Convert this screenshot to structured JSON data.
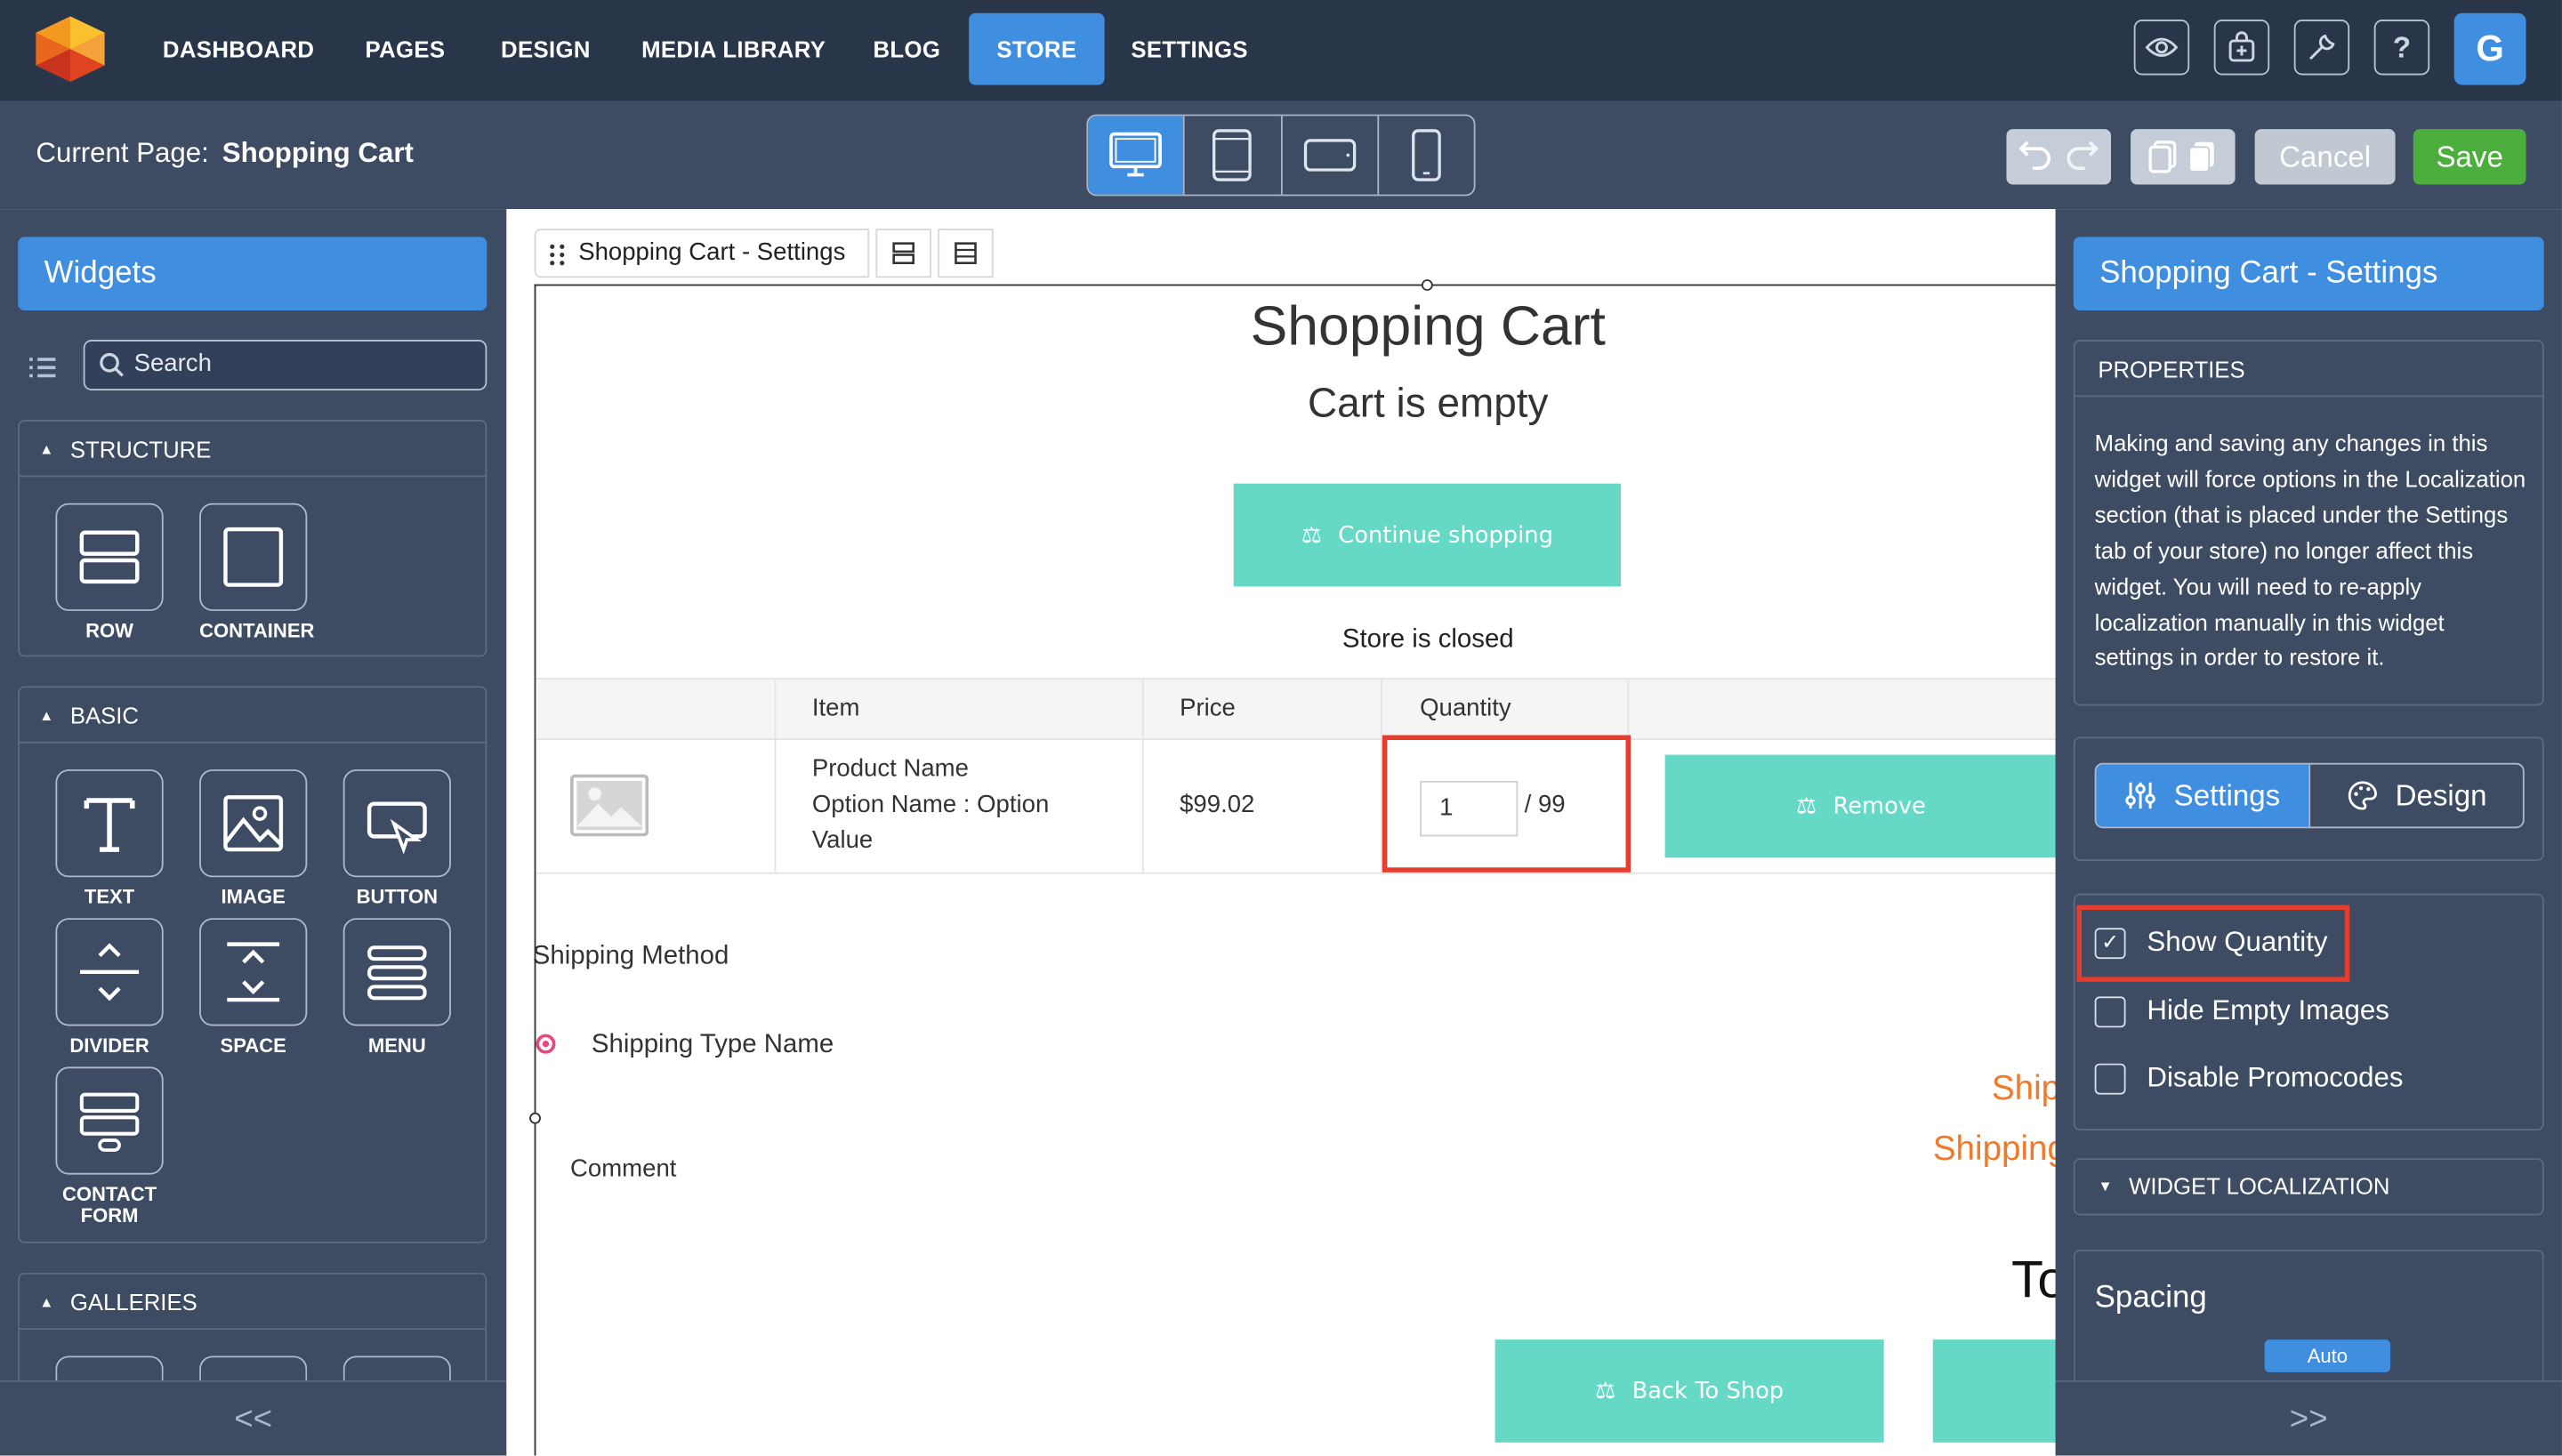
{
  "topnav": {
    "items": [
      "DASHBOARD",
      "PAGES",
      "DESIGN",
      "MEDIA LIBRARY",
      "BLOG",
      "STORE",
      "SETTINGS"
    ],
    "active": "STORE",
    "icons": [
      "eye-icon",
      "store-icon",
      "wrench-icon",
      "help-icon"
    ],
    "help_glyph": "?",
    "avatar_letter": "G"
  },
  "subbar": {
    "current_page_label": "Current Page:",
    "current_page_value": "Shopping Cart",
    "devices": [
      "desktop-icon",
      "tablet-icon",
      "tablet-landscape-icon",
      "mobile-icon"
    ],
    "cancel_label": "Cancel",
    "save_label": "Save"
  },
  "left_panel": {
    "title": "Widgets",
    "search_placeholder": "Search",
    "sections": {
      "structure": {
        "title": "STRUCTURE",
        "widgets": [
          "ROW",
          "CONTAINER"
        ]
      },
      "basic": {
        "title": "BASIC",
        "widgets": [
          "TEXT",
          "IMAGE",
          "BUTTON",
          "DIVIDER",
          "SPACE",
          "MENU",
          "CONTACT FORM"
        ]
      },
      "galleries": {
        "title": "GALLERIES"
      }
    },
    "collapse_glyph": "<<"
  },
  "canvas": {
    "breadcrumb": "Shopping Cart - Settings",
    "heading": "Shopping Cart",
    "empty_message": "Cart is empty",
    "continue_label": "Continue shopping",
    "store_closed": "Store is closed",
    "table": {
      "headers": [
        "Item",
        "Price",
        "Quantity"
      ],
      "row": {
        "item_lines": [
          "Product Name",
          "Option Name : Option",
          "Value"
        ],
        "price": "$99.02",
        "quantity": "1",
        "max": "/ 99",
        "remove_label": "Remove"
      }
    },
    "shipping_method": "Shipping Method",
    "shipping_type": "Shipping Type Name",
    "comment": "Comment",
    "orange_1": "Ship",
    "orange_2": "Shipping",
    "total_partial": "To",
    "back_label": "Back To Shop",
    "accent": "#66d9c6",
    "highlight": "#e63d2e"
  },
  "right_panel": {
    "title": "Shopping Cart - Settings",
    "properties_title": "PROPERTIES",
    "properties_text": "Making and saving any changes in this widget will force options in the Localization section (that is placed under the Settings tab of your store) no longer affect this widget. You will need to re-apply localization manually in this widget settings in order to restore it.",
    "tab_settings": "Settings",
    "tab_design": "Design",
    "checkboxes": [
      {
        "label": "Show Quantity",
        "checked": true
      },
      {
        "label": "Hide Empty Images",
        "checked": false
      },
      {
        "label": "Disable Promocodes",
        "checked": false
      }
    ],
    "check_glyph": "✓",
    "localization_title": "WIDGET LOCALIZATION",
    "spacing_title": "Spacing",
    "spacing_value": "Auto",
    "expand_glyph": ">>"
  }
}
